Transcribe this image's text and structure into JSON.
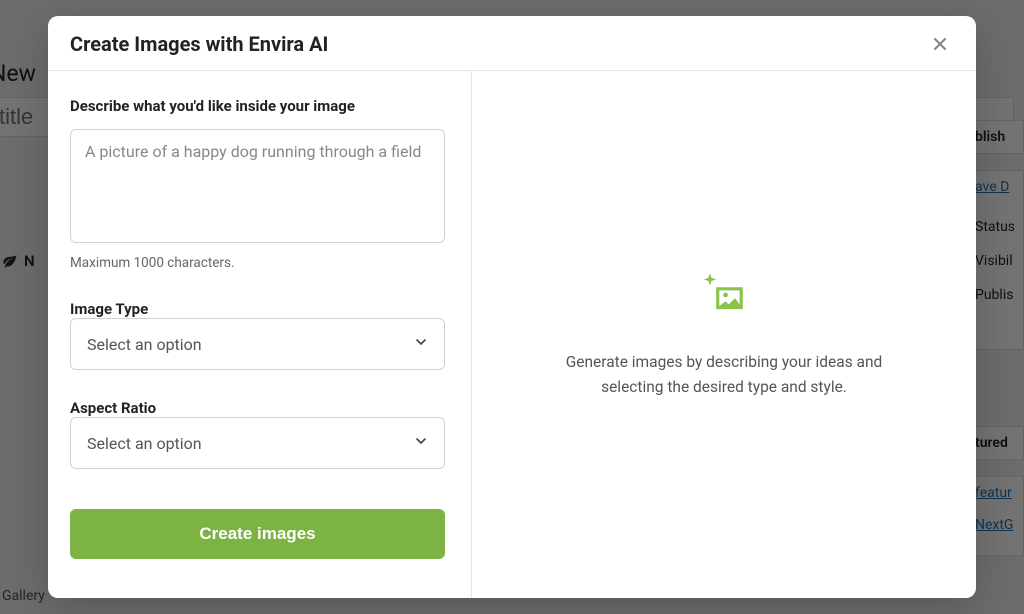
{
  "background": {
    "page_title": "New",
    "title_placeholder": "title",
    "native_label": "N",
    "gallery_label": "Gallery",
    "sidebar": {
      "publish": "blish",
      "save_draft": "ave D",
      "status": "Status",
      "visibility": "Visibil",
      "publish_date": "Publis",
      "featured": "tured",
      "featured_link": "featur",
      "next_link": "NextG"
    }
  },
  "modal": {
    "title": "Create Images with Envira AI",
    "describe": {
      "label": "Describe what you'd like inside your image",
      "placeholder": "A picture of a happy dog running through a field",
      "helper": "Maximum 1000 characters."
    },
    "image_type": {
      "label": "Image Type",
      "placeholder": "Select an option"
    },
    "aspect_ratio": {
      "label": "Aspect Ratio",
      "placeholder": "Select an option"
    },
    "create_button": "Create images",
    "preview": {
      "text": "Generate images by describing your ideas and selecting the desired type and style."
    }
  }
}
